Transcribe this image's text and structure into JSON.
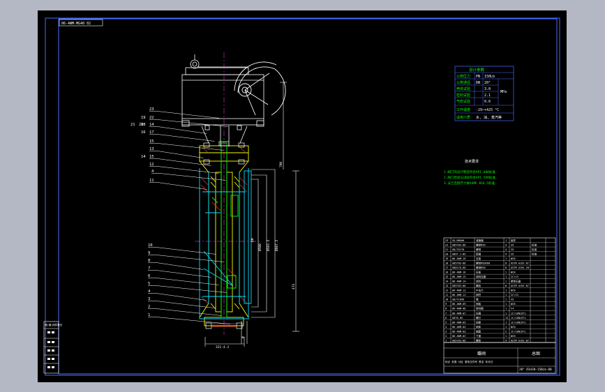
{
  "drawing": {
    "code_box": "06-4WM-MG40 02",
    "part_labels": [
      "23",
      "19",
      "22",
      "18",
      "14",
      "21",
      "20",
      "16",
      "17",
      "15",
      "13",
      "14",
      "15",
      "12",
      "4",
      "11",
      "10",
      "9",
      "8",
      "7",
      "6",
      "5",
      "4",
      "3",
      "2",
      "1"
    ],
    "dim_labels": [
      "DN",
      "Ø500",
      "Ø583.5",
      "Ø607.5",
      "790",
      "474",
      "321.4.3",
      "Ø"
    ],
    "spec_table": {
      "title": "设计参数",
      "rows": [
        {
          "k": "公称压力",
          "u": "PN",
          "v": "150Lb"
        },
        {
          "k": "公称通径",
          "u": "DN",
          "v": "20\""
        },
        {
          "k": "壳体试验",
          "u": "",
          "v": "3.0"
        },
        {
          "k": "密封试验",
          "u": "",
          "v": "2.1"
        },
        {
          "k": "气密试验",
          "u": "",
          "v": "0.6"
        },
        {
          "k": "工作温度",
          "u": "",
          "v": "-29~+425 °C"
        },
        {
          "k": "适用介质",
          "u": "",
          "v": "水, 油, 蒸汽等"
        }
      ],
      "unit": "MPa"
    },
    "tech_title": "技术要求",
    "tech_notes": [
      "1.阀门的设计制造符合API 600标准.",
      "2.阀门检验与试验符合API 598标准.",
      "3.法兰连接尺寸按ASME B16.5标准."
    ],
    "bom_rows": [
      [
        "23",
        "SQ-DN500",
        "减速器",
        "1",
        "组件",
        ""
      ],
      [
        "22",
        "GB5783-86",
        "螺栓M16",
        "4",
        "35",
        "标准"
      ],
      [
        "21",
        "GB/T6170",
        "螺母",
        "4",
        "35",
        "标准"
      ],
      [
        "20",
        "GB97.1-85",
        "垫圈",
        "4",
        "35",
        "标准"
      ],
      [
        "19",
        "06-4WM-19",
        "支架",
        "1",
        "WCB",
        ""
      ],
      [
        "18",
        "GB5783-86",
        "螺栓M20X60",
        "8",
        "ASTM A193 B7",
        ""
      ],
      [
        "17",
        "GB6170-86",
        "螺母M20",
        "8",
        "ASTM A194 2H",
        ""
      ],
      [
        "16",
        "06-4WM-16",
        "压板",
        "1",
        "WCB",
        ""
      ],
      [
        "15",
        "06-4WM-15",
        "填料压套",
        "1",
        "2Cr13",
        ""
      ],
      [
        "14",
        "06-4WM-14",
        "填料",
        "1",
        "柔性石墨",
        ""
      ],
      [
        "13",
        "GB5783-86",
        "螺栓",
        "8",
        "ASTM A193 B7",
        ""
      ],
      [
        "12",
        "06-4WM-12",
        "中法兰",
        "1",
        "WCB",
        ""
      ],
      [
        "11",
        "06-4WM-11",
        "阀杆",
        "1",
        "2Cr13",
        ""
      ],
      [
        "10",
        "GB/T1096",
        "键",
        "1",
        "45",
        ""
      ],
      [
        "9",
        "06-4WM-09",
        "阀板",
        "1",
        "WCB",
        ""
      ],
      [
        "8",
        "06-4WM-08",
        "密封圈",
        "1",
        "F4",
        ""
      ],
      [
        "7",
        "06-4WM-07",
        "压圈",
        "1",
        "1Cr18Ni9Ti",
        ""
      ],
      [
        "6",
        "GB70-85",
        "螺钉",
        "12",
        "1Cr18Ni9Ti",
        ""
      ],
      [
        "5",
        "06-4WM-05",
        "阀座",
        "1",
        "1Cr18Ni9Ti",
        ""
      ],
      [
        "4",
        "06-4WM-04",
        "阀体",
        "1",
        "WCB",
        ""
      ],
      [
        "3",
        "06-4WM-03",
        "轴套",
        "2",
        "1Cr18Ni9Ti",
        ""
      ],
      [
        "2",
        "06-4WM-02",
        "下盖",
        "1",
        "WCB",
        ""
      ],
      [
        "1",
        "GB5783-86",
        "螺栓",
        "4",
        "ASTM A193 B7",
        ""
      ]
    ],
    "title_block": {
      "name": "蝶阀",
      "label": "总图",
      "drawing_no": "20\" D343H-150Lb-00",
      "header": "标记 处数 分区 更改文件号 签名 年月日"
    },
    "side_stamp": "借(通)用件登记"
  }
}
